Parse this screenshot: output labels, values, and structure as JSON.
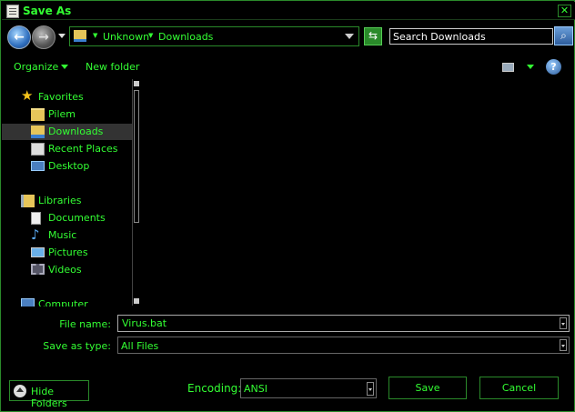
{
  "window": {
    "title": "Save As",
    "close_glyph": "✕"
  },
  "nav": {
    "back_glyph": "←",
    "forward_glyph": "→",
    "breadcrumb": [
      "Unknown",
      "Downloads"
    ],
    "search_placeholder": "Search Downloads",
    "icons": {
      "back": "back-arrow-icon",
      "forward": "forward-arrow-icon",
      "refresh": "refresh-icon",
      "search": "search-icon"
    }
  },
  "toolbar": {
    "organize_label": "Organize",
    "new_folder_label": "New folder",
    "help_glyph": "?"
  },
  "sidebar": {
    "favorites": {
      "label": "Favorites",
      "items": [
        "Pilem",
        "Downloads",
        "Recent Places",
        "Desktop"
      ],
      "selected": "Downloads"
    },
    "libraries": {
      "label": "Libraries",
      "items": [
        "Documents",
        "Music",
        "Pictures",
        "Videos"
      ]
    },
    "computer_label": "Computer"
  },
  "form": {
    "file_name_label": "File name:",
    "file_name_value": "Virus.bat",
    "save_type_label": "Save as type:",
    "save_type_value": "All Files"
  },
  "footer": {
    "hide_folders_label": "Hide Folders",
    "encoding_label": "Encoding:",
    "encoding_value": "ANSI",
    "save_label": "Save",
    "cancel_label": "Cancel"
  },
  "colors": {
    "text": "#33ff33",
    "background": "#000000",
    "border": "#2a8a2a"
  }
}
